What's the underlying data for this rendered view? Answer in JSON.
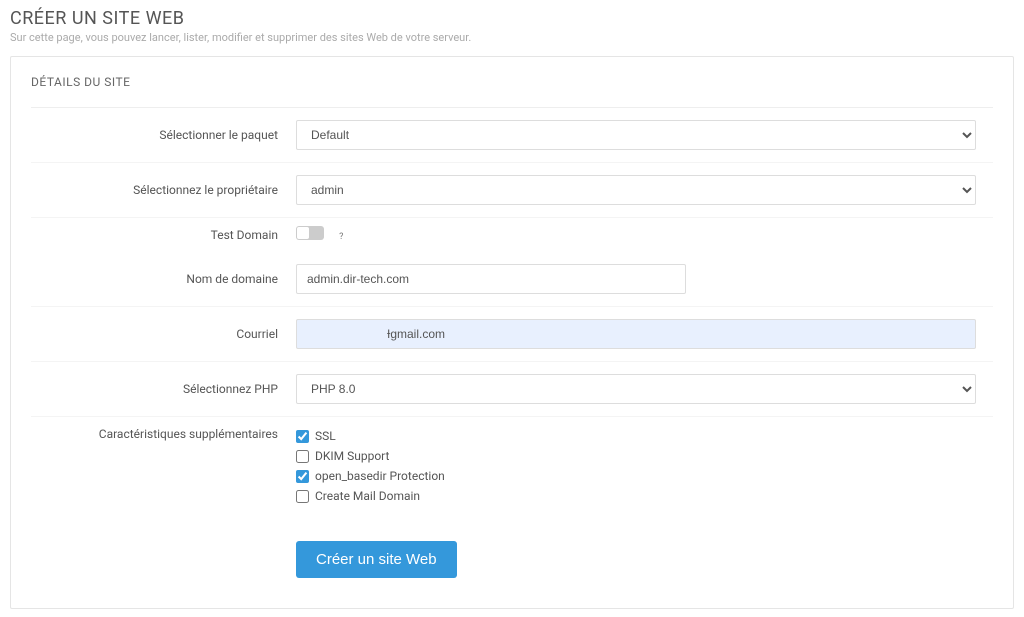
{
  "page": {
    "title": "CRÉER UN SITE WEB",
    "subtitle": "Sur cette page, vous pouvez lancer, lister, modifier et supprimer des sites Web de votre serveur."
  },
  "panel": {
    "header": "DÉTAILS DU SITE"
  },
  "form": {
    "package": {
      "label": "Sélectionner le paquet",
      "value": "Default"
    },
    "owner": {
      "label": "Sélectionnez le propriétaire",
      "value": "admin"
    },
    "test_domain": {
      "label": "Test Domain"
    },
    "domain": {
      "label": "Nom de domaine",
      "value": "admin.dir-tech.com"
    },
    "email": {
      "label": "Courriel",
      "value": "Ɨgmail.com"
    },
    "php": {
      "label": "Sélectionnez PHP",
      "value": "PHP 8.0"
    },
    "features": {
      "label": "Caractéristiques supplémentaires",
      "ssl": {
        "label": "SSL",
        "checked": true
      },
      "dkim": {
        "label": "DKIM Support",
        "checked": false
      },
      "open_basedir": {
        "label": "open_basedir Protection",
        "checked": true
      },
      "mail_domain": {
        "label": "Create Mail Domain",
        "checked": false
      }
    },
    "submit": "Créer un site Web"
  }
}
